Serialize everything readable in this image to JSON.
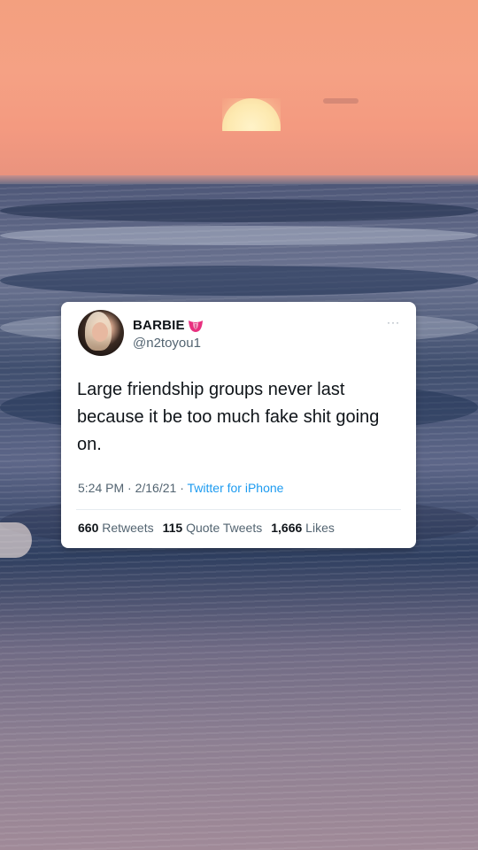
{
  "tweet": {
    "display_name": "BARBIE",
    "handle": "@n2toyou1",
    "text": "Large friendship groups never last because it be too much fake shit going on.",
    "time": "5:24 PM",
    "date": "2/16/21",
    "source": "Twitter for iPhone",
    "retweets": {
      "count": "660",
      "label": "Retweets"
    },
    "quote_tweets": {
      "count": "115",
      "label": "Quote Tweets"
    },
    "likes": {
      "count": "1,666",
      "label": "Likes"
    },
    "more_glyph": "···",
    "meta_separator": " · "
  },
  "icons": {
    "name_emoji": "tongue-emoji-icon",
    "more": "more-options-icon"
  },
  "colors": {
    "link": "#1d9bf0",
    "secondary_text": "#536471",
    "primary_text": "#0f1419"
  }
}
